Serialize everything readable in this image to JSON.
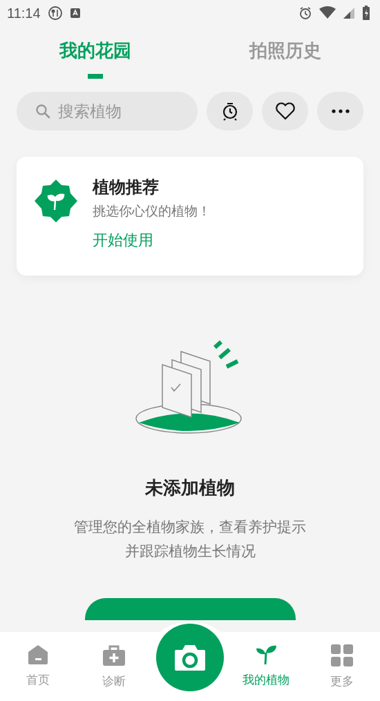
{
  "status_bar": {
    "time": "11:14"
  },
  "tabs": [
    {
      "label": "我的花园",
      "selected": true
    },
    {
      "label": "拍照历史",
      "selected": false
    }
  ],
  "search": {
    "placeholder": "搜索植物"
  },
  "recommend_card": {
    "title": "植物推荐",
    "subtitle": "挑选你心仪的植物！",
    "link": "开始使用"
  },
  "empty_state": {
    "title": "未添加植物",
    "description": [
      "管理您的全植物家族，查看养护提示",
      "并跟踪植物生长情况"
    ]
  },
  "bottom_nav": [
    {
      "kind": "home",
      "label": "首页",
      "selected": false
    },
    {
      "kind": "diagnose",
      "label": "诊断",
      "selected": false
    },
    {
      "kind": "camera",
      "selected": false
    },
    {
      "kind": "plants",
      "label": "我的植物",
      "selected": true
    },
    {
      "kind": "more",
      "label": "更多",
      "selected": false
    }
  ]
}
